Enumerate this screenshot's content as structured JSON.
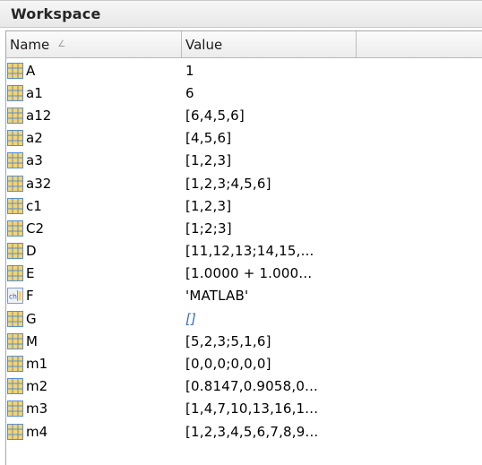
{
  "panel": {
    "title": "Workspace"
  },
  "table": {
    "columns": [
      {
        "label": "Name",
        "sort_indicator": "∠"
      },
      {
        "label": "Value"
      }
    ],
    "rows": [
      {
        "name": "A",
        "value": "1",
        "icon": "matrix-icon"
      },
      {
        "name": "a1",
        "value": "6",
        "icon": "matrix-icon"
      },
      {
        "name": "a12",
        "value": "[6,4,5,6]",
        "icon": "matrix-icon"
      },
      {
        "name": "a2",
        "value": "[4,5,6]",
        "icon": "matrix-icon"
      },
      {
        "name": "a3",
        "value": "[1,2,3]",
        "icon": "matrix-icon"
      },
      {
        "name": "a32",
        "value": "[1,2,3;4,5,6]",
        "icon": "matrix-icon"
      },
      {
        "name": "c1",
        "value": "[1,2,3]",
        "icon": "matrix-icon"
      },
      {
        "name": "C2",
        "value": "[1;2;3]",
        "icon": "matrix-icon"
      },
      {
        "name": "D",
        "value": "[11,12,13;14,15,...",
        "icon": "matrix-icon"
      },
      {
        "name": "E",
        "value": "[1.0000 + 1.000...",
        "icon": "matrix-icon"
      },
      {
        "name": "F",
        "value": "'MATLAB'",
        "icon": "char-icon"
      },
      {
        "name": "G",
        "value": "[]",
        "icon": "matrix-icon",
        "empty": true
      },
      {
        "name": "M",
        "value": "[5,2,3;5,1,6]",
        "icon": "matrix-icon"
      },
      {
        "name": "m1",
        "value": "[0,0,0;0,0,0]",
        "icon": "matrix-icon"
      },
      {
        "name": "m2",
        "value": "[0.8147,0.9058,0...",
        "icon": "matrix-icon"
      },
      {
        "name": "m3",
        "value": "[1,4,7,10,13,16,1...",
        "icon": "matrix-icon"
      },
      {
        "name": "m4",
        "value": "[1,2,3,4,5,6,7,8,9...",
        "icon": "matrix-icon"
      }
    ]
  },
  "colors": {
    "matrix_icon_fill": "#f7d36b",
    "matrix_icon_grid": "#5a8fd0",
    "empty_value": "#3b6fb6"
  }
}
